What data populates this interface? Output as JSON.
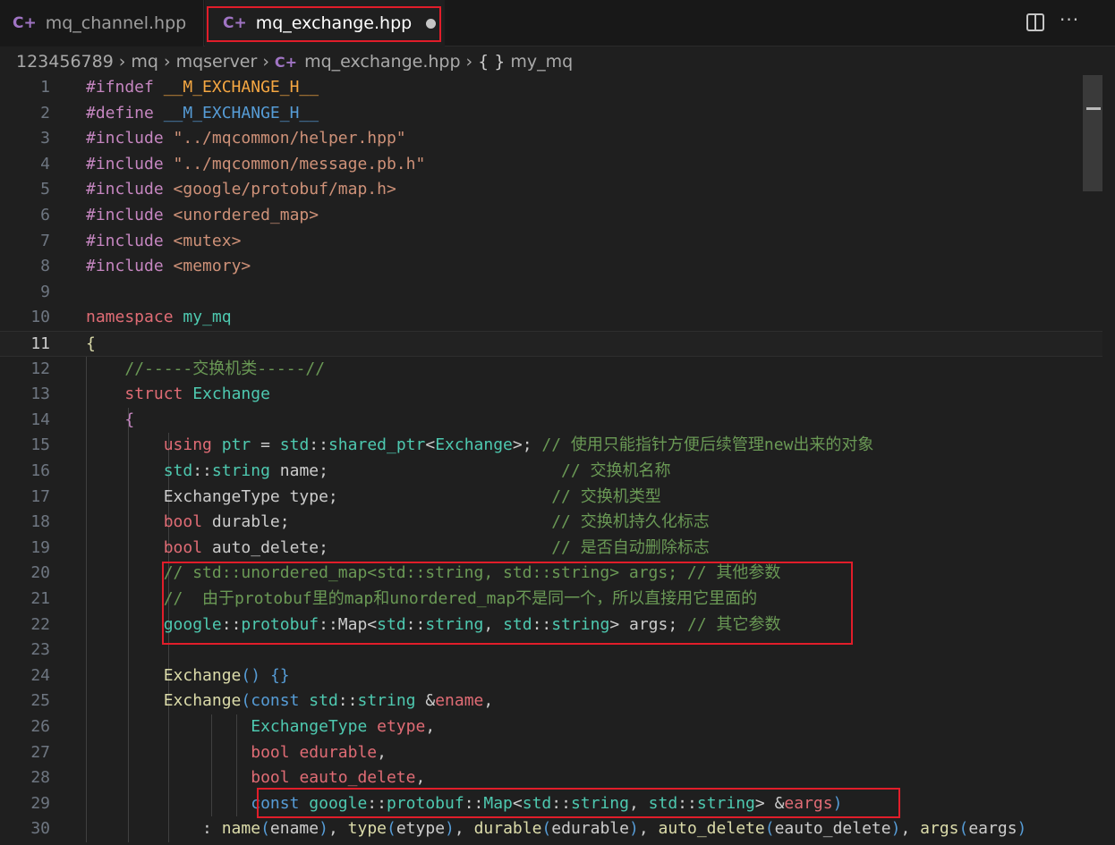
{
  "tabs": [
    {
      "label": "mq_channel.hpp",
      "icon": "cpp-file-icon",
      "active": false
    },
    {
      "label": "mq_exchange.hpp",
      "icon": "cpp-file-icon",
      "active": true,
      "modified": true
    }
  ],
  "breadcrumb": {
    "items": [
      "123456789",
      "mq",
      "mqserver",
      "mq_exchange.hpp",
      "my_mq"
    ],
    "file_icon": "cpp-file-icon",
    "symbol_icon": "braces-icon"
  },
  "editor": {
    "current_line": 11,
    "line_numbers": [
      "1",
      "2",
      "3",
      "4",
      "5",
      "6",
      "7",
      "8",
      "9",
      "10",
      "11",
      "12",
      "13",
      "14",
      "15",
      "16",
      "17",
      "18",
      "19",
      "20",
      "21",
      "22",
      "23",
      "24",
      "25",
      "26",
      "27",
      "28",
      "29",
      "30"
    ],
    "lines": [
      [
        [
          "ctl",
          "#ifndef"
        ],
        [
          "plain",
          " "
        ],
        [
          "macname",
          "__M_EXCHANGE_H__"
        ]
      ],
      [
        [
          "ctl",
          "#define"
        ],
        [
          "plain",
          " "
        ],
        [
          "mac",
          "__M_EXCHANGE_H__"
        ]
      ],
      [
        [
          "ctl",
          "#include"
        ],
        [
          "plain",
          " "
        ],
        [
          "str",
          "\"../mqcommon/helper.hpp\""
        ]
      ],
      [
        [
          "ctl",
          "#include"
        ],
        [
          "plain",
          " "
        ],
        [
          "str",
          "\"../mqcommon/message.pb.h\""
        ]
      ],
      [
        [
          "ctl",
          "#include"
        ],
        [
          "plain",
          " "
        ],
        [
          "str",
          "<google/protobuf/map.h>"
        ]
      ],
      [
        [
          "ctl",
          "#include"
        ],
        [
          "plain",
          " "
        ],
        [
          "str",
          "<unordered_map>"
        ]
      ],
      [
        [
          "ctl",
          "#include"
        ],
        [
          "plain",
          " "
        ],
        [
          "str",
          "<mutex>"
        ]
      ],
      [
        [
          "ctl",
          "#include"
        ],
        [
          "plain",
          " "
        ],
        [
          "str",
          "<memory>"
        ]
      ],
      [],
      [
        [
          "kw2",
          "namespace"
        ],
        [
          "plain",
          " "
        ],
        [
          "typ",
          "my_mq"
        ]
      ],
      [
        [
          "fn",
          "{"
        ]
      ],
      [
        [
          "plain",
          "    "
        ],
        [
          "cm",
          "//-----交换机类-----//"
        ]
      ],
      [
        [
          "plain",
          "    "
        ],
        [
          "kw2",
          "struct"
        ],
        [
          "plain",
          " "
        ],
        [
          "typ",
          "Exchange"
        ]
      ],
      [
        [
          "plain",
          "    "
        ],
        [
          "pur",
          "{"
        ]
      ],
      [
        [
          "plain",
          "        "
        ],
        [
          "kw2",
          "using"
        ],
        [
          "plain",
          " "
        ],
        [
          "typ",
          "ptr"
        ],
        [
          "plain",
          " = "
        ],
        [
          "typ",
          "std"
        ],
        [
          "plain",
          "::"
        ],
        [
          "typ",
          "shared_ptr"
        ],
        [
          "plain",
          "<"
        ],
        [
          "typ",
          "Exchange"
        ],
        [
          "plain",
          ">; "
        ],
        [
          "cm",
          "// 使用只能指针方便后续管理new出来的对象"
        ]
      ],
      [
        [
          "plain",
          "        "
        ],
        [
          "typ",
          "std"
        ],
        [
          "plain",
          "::"
        ],
        [
          "typ",
          "string"
        ],
        [
          "plain",
          " name;                        "
        ],
        [
          "cm",
          "// 交换机名称"
        ]
      ],
      [
        [
          "plain",
          "        "
        ],
        [
          "plain",
          "ExchangeType type;                      "
        ],
        [
          "cm",
          "// 交换机类型"
        ]
      ],
      [
        [
          "plain",
          "        "
        ],
        [
          "kw2",
          "bool"
        ],
        [
          "plain",
          " durable;                           "
        ],
        [
          "cm",
          "// 交换机持久化标志"
        ]
      ],
      [
        [
          "plain",
          "        "
        ],
        [
          "kw2",
          "bool"
        ],
        [
          "plain",
          " auto_delete;                       "
        ],
        [
          "cm",
          "// 是否自动删除标志"
        ]
      ],
      [
        [
          "plain",
          "        "
        ],
        [
          "cm",
          "// std::unordered_map<std::string, std::string> args; // 其他参数"
        ]
      ],
      [
        [
          "plain",
          "        "
        ],
        [
          "cm",
          "//  由于protobuf里的map和unordered_map不是同一个，所以直接用它里面的"
        ]
      ],
      [
        [
          "plain",
          "        "
        ],
        [
          "typ",
          "google"
        ],
        [
          "plain",
          "::"
        ],
        [
          "typ",
          "protobuf"
        ],
        [
          "plain",
          "::Map<"
        ],
        [
          "typ",
          "std"
        ],
        [
          "plain",
          "::"
        ],
        [
          "typ",
          "string"
        ],
        [
          "plain",
          ", "
        ],
        [
          "typ",
          "std"
        ],
        [
          "plain",
          "::"
        ],
        [
          "typ",
          "string"
        ],
        [
          "plain",
          "> args; "
        ],
        [
          "cm",
          "// 其它参数"
        ]
      ],
      [],
      [
        [
          "plain",
          "        "
        ],
        [
          "fn",
          "Exchange"
        ],
        [
          "kw",
          "()"
        ],
        [
          "plain",
          " "
        ],
        [
          "kw",
          "{}"
        ]
      ],
      [
        [
          "plain",
          "        "
        ],
        [
          "fn",
          "Exchange"
        ],
        [
          "kw",
          "("
        ],
        [
          "kw",
          "const"
        ],
        [
          "plain",
          " "
        ],
        [
          "typ",
          "std"
        ],
        [
          "plain",
          "::"
        ],
        [
          "typ",
          "string"
        ],
        [
          "plain",
          " &"
        ],
        [
          "kw2",
          "ename"
        ],
        [
          "plain",
          ","
        ]
      ],
      [
        [
          "plain",
          "                 "
        ],
        [
          "typ",
          "ExchangeType"
        ],
        [
          "plain",
          " "
        ],
        [
          "kw2",
          "etype"
        ],
        [
          "plain",
          ","
        ]
      ],
      [
        [
          "plain",
          "                 "
        ],
        [
          "kw2",
          "bool"
        ],
        [
          "plain",
          " "
        ],
        [
          "kw2",
          "edurable"
        ],
        [
          "plain",
          ","
        ]
      ],
      [
        [
          "plain",
          "                 "
        ],
        [
          "kw2",
          "bool"
        ],
        [
          "plain",
          " "
        ],
        [
          "kw2",
          "eauto_delete"
        ],
        [
          "plain",
          ","
        ]
      ],
      [
        [
          "plain",
          "                 "
        ],
        [
          "kw",
          "const"
        ],
        [
          "plain",
          " "
        ],
        [
          "typ",
          "google"
        ],
        [
          "plain",
          "::"
        ],
        [
          "typ",
          "protobuf"
        ],
        [
          "plain",
          "::"
        ],
        [
          "typ",
          "Map"
        ],
        [
          "plain",
          "<"
        ],
        [
          "typ",
          "std"
        ],
        [
          "plain",
          "::"
        ],
        [
          "typ",
          "string"
        ],
        [
          "plain",
          ", "
        ],
        [
          "typ",
          "std"
        ],
        [
          "plain",
          "::"
        ],
        [
          "typ",
          "string"
        ],
        [
          "plain",
          "> &"
        ],
        [
          "kw2",
          "eargs"
        ],
        [
          "kw",
          ")"
        ]
      ],
      [
        [
          "plain",
          "            : "
        ],
        [
          "fn",
          "name"
        ],
        [
          "kw",
          "("
        ],
        [
          "plain",
          "ename"
        ],
        [
          "kw",
          ")"
        ],
        [
          "plain",
          ", "
        ],
        [
          "fn",
          "type"
        ],
        [
          "kw",
          "("
        ],
        [
          "plain",
          "etype"
        ],
        [
          "kw",
          ")"
        ],
        [
          "plain",
          ", "
        ],
        [
          "fn",
          "durable"
        ],
        [
          "kw",
          "("
        ],
        [
          "plain",
          "edurable"
        ],
        [
          "kw",
          ")"
        ],
        [
          "plain",
          ", "
        ],
        [
          "fn",
          "auto_delete"
        ],
        [
          "kw",
          "("
        ],
        [
          "plain",
          "eauto_delete"
        ],
        [
          "kw",
          ")"
        ],
        [
          "plain",
          ", "
        ],
        [
          "fn",
          "args"
        ],
        [
          "kw",
          "("
        ],
        [
          "plain",
          "eargs"
        ],
        [
          "kw",
          ")"
        ]
      ]
    ]
  },
  "highlights": [
    {
      "label": "tab",
      "target": "mq_exchange.hpp"
    },
    {
      "label": "lines",
      "range": [
        20,
        22
      ]
    },
    {
      "label": "line",
      "range": [
        29,
        29
      ]
    }
  ],
  "colors": {
    "highlight_border": "#e11d2a",
    "editor_bg": "#1f1f1f",
    "keyword_red": "#e06c75",
    "type_teal": "#4ec9b0",
    "comment_green": "#6a9955",
    "string_orange": "#ce9178"
  }
}
